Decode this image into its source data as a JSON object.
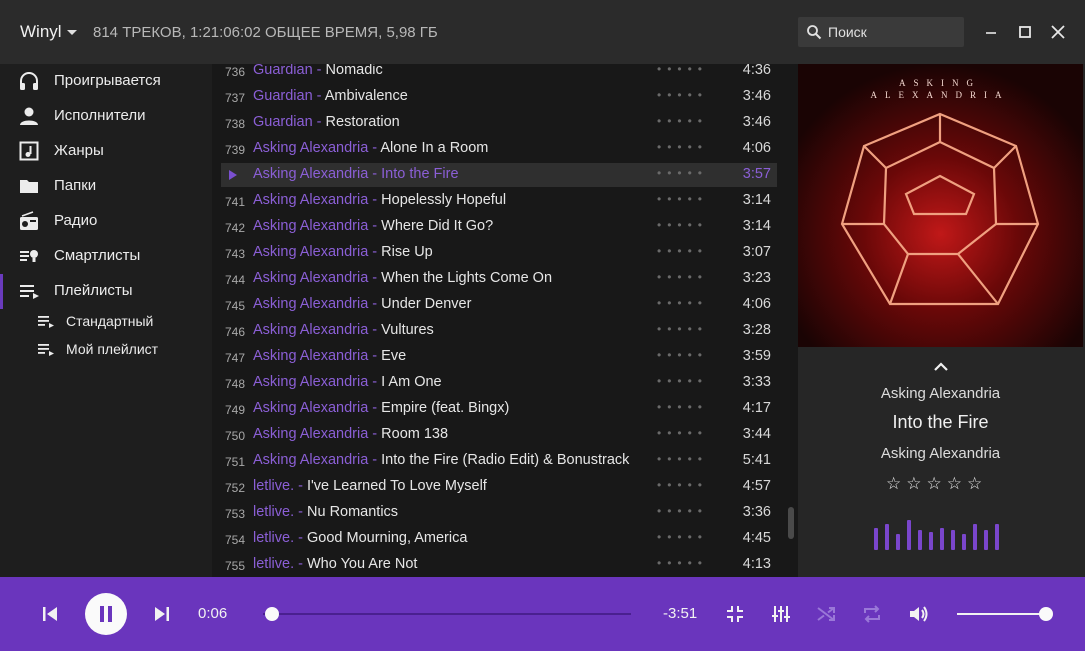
{
  "app": {
    "name": "Winyl",
    "stats": "814 ТРЕКОВ, 1:21:06:02 ОБЩЕЕ ВРЕМЯ, 5,98 ГБ"
  },
  "search": {
    "placeholder": "Поиск"
  },
  "icons": {
    "search": "search-icon",
    "minimize": "minimize-icon",
    "maximize": "maximize-icon",
    "close": "close-icon",
    "now_playing": "headphones-icon",
    "artists": "person-icon",
    "genres": "music-note-icon",
    "folders": "folder-icon",
    "radio": "radio-icon",
    "smartlists": "smartlist-icon",
    "playlists": "playlist-icon"
  },
  "sidebar": {
    "items": [
      {
        "label": "Проигрывается"
      },
      {
        "label": "Исполнители"
      },
      {
        "label": "Жанры"
      },
      {
        "label": "Папки"
      },
      {
        "label": "Радио"
      },
      {
        "label": "Смартлисты"
      },
      {
        "label": "Плейлисты"
      }
    ],
    "subitems": [
      {
        "label": "Стандартный"
      },
      {
        "label": "Мой плейлист"
      }
    ],
    "active_index": 6
  },
  "tracks": [
    {
      "num": "736",
      "artist": "Guardian",
      "title": "Nomadic",
      "duration": "4:36"
    },
    {
      "num": "737",
      "artist": "Guardian",
      "title": "Ambivalence",
      "duration": "3:46"
    },
    {
      "num": "738",
      "artist": "Guardian",
      "title": "Restoration",
      "duration": "3:46"
    },
    {
      "num": "739",
      "artist": "Asking Alexandria",
      "title": "Alone In a Room",
      "duration": "4:06"
    },
    {
      "num": "",
      "artist": "Asking Alexandria",
      "title": "Into the Fire",
      "duration": "3:57",
      "playing": true
    },
    {
      "num": "741",
      "artist": "Asking Alexandria",
      "title": "Hopelessly Hopeful",
      "duration": "3:14"
    },
    {
      "num": "742",
      "artist": "Asking Alexandria",
      "title": "Where Did It Go?",
      "duration": "3:14"
    },
    {
      "num": "743",
      "artist": "Asking Alexandria",
      "title": "Rise Up",
      "duration": "3:07"
    },
    {
      "num": "744",
      "artist": "Asking Alexandria",
      "title": "When the Lights Come On",
      "duration": "3:23"
    },
    {
      "num": "745",
      "artist": "Asking Alexandria",
      "title": "Under Denver",
      "duration": "4:06"
    },
    {
      "num": "746",
      "artist": "Asking Alexandria",
      "title": "Vultures",
      "duration": "3:28"
    },
    {
      "num": "747",
      "artist": "Asking Alexandria",
      "title": "Eve",
      "duration": "3:59"
    },
    {
      "num": "748",
      "artist": "Asking Alexandria",
      "title": "I Am One",
      "duration": "3:33"
    },
    {
      "num": "749",
      "artist": "Asking Alexandria",
      "title": "Empire (feat. Bingx)",
      "duration": "4:17"
    },
    {
      "num": "750",
      "artist": "Asking Alexandria",
      "title": "Room 138",
      "duration": "3:44"
    },
    {
      "num": "751",
      "artist": "Asking Alexandria",
      "title": "Into the Fire (Radio Edit) & Bonustrack",
      "duration": "5:41"
    },
    {
      "num": "752",
      "artist": "letlive.",
      "title": "I've Learned To Love Myself",
      "duration": "4:57"
    },
    {
      "num": "753",
      "artist": "letlive.",
      "title": "Nu Romantics",
      "duration": "3:36"
    },
    {
      "num": "754",
      "artist": "letlive.",
      "title": "Good Mourning, America",
      "duration": "4:45"
    },
    {
      "num": "755",
      "artist": "letlive.",
      "title": "Who You Are Not",
      "duration": "4:13"
    }
  ],
  "separator": " - ",
  "rating_dots": "•••••",
  "now_playing": {
    "cover_text_line1": "ASKING",
    "cover_text_line2": "ALEXANDRIA",
    "artist": "Asking Alexandria",
    "title": "Into the Fire",
    "album": "Asking Alexandria",
    "stars": "☆☆☆☆☆",
    "rating": 0
  },
  "player": {
    "elapsed": "0:06",
    "remaining": "-3:51",
    "progress": 0.025,
    "volume": 1.0
  },
  "colors": {
    "accent": "#6a35bd",
    "artist_text": "#8b5fd6",
    "background": "#181818"
  }
}
